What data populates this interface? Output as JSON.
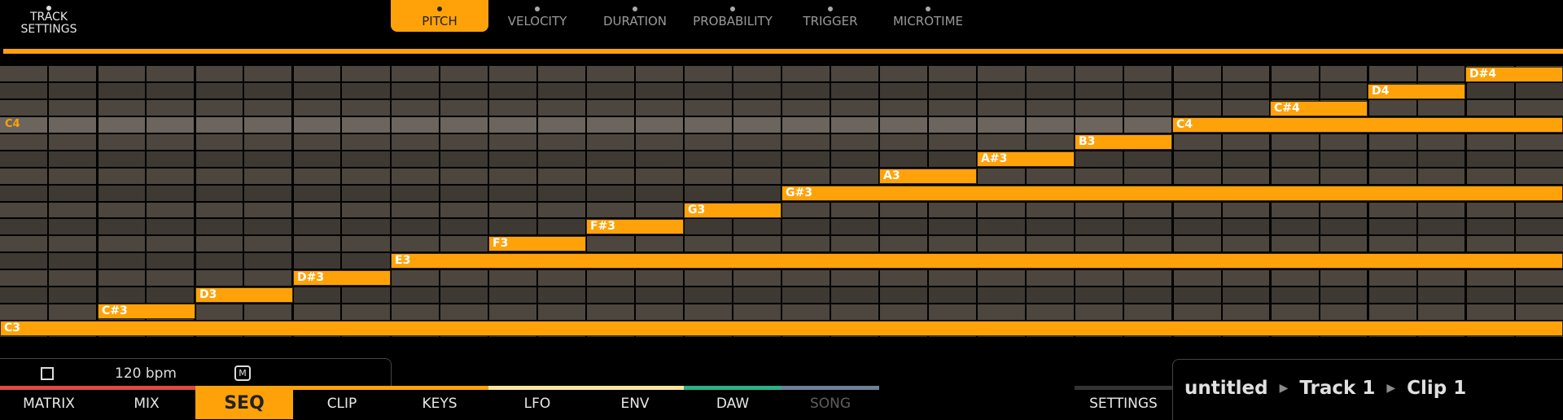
{
  "header": {
    "track_settings": "TRACK\nSETTINGS",
    "tabs": [
      {
        "label": "PITCH"
      },
      {
        "label": "VELOCITY"
      },
      {
        "label": "DURATION"
      },
      {
        "label": "PROBABILITY"
      },
      {
        "label": "TRIGGER"
      },
      {
        "label": "MICROTIME"
      }
    ],
    "active_tab": "PITCH"
  },
  "piano_roll": {
    "row_label": "C4",
    "notes": [
      {
        "label": "D#4",
        "step": 30,
        "length": 2,
        "row": 0
      },
      {
        "label": "D4",
        "step": 28,
        "length": 2,
        "row": 1
      },
      {
        "label": "C#4",
        "step": 26,
        "length": 2,
        "row": 2
      },
      {
        "label": "C4",
        "step": 24,
        "length": 8,
        "row": 3
      },
      {
        "label": "B3",
        "step": 22,
        "length": 2,
        "row": 4
      },
      {
        "label": "A#3",
        "step": 20,
        "length": 2,
        "row": 5
      },
      {
        "label": "A3",
        "step": 18,
        "length": 2,
        "row": 6
      },
      {
        "label": "G#3",
        "step": 16,
        "length": 16,
        "row": 7
      },
      {
        "label": "G3",
        "step": 14,
        "length": 2,
        "row": 8
      },
      {
        "label": "F#3",
        "step": 12,
        "length": 2,
        "row": 9
      },
      {
        "label": "F3",
        "step": 10,
        "length": 2,
        "row": 10
      },
      {
        "label": "E3",
        "step": 8,
        "length": 24,
        "row": 11
      },
      {
        "label": "D#3",
        "step": 6,
        "length": 2,
        "row": 12
      },
      {
        "label": "D3",
        "step": 4,
        "length": 2,
        "row": 13
      },
      {
        "label": "C#3",
        "step": 2,
        "length": 2,
        "row": 14
      },
      {
        "label": "C3",
        "step": 0,
        "length": 32,
        "row": 15
      }
    ]
  },
  "transport": {
    "bpm": "120 bpm",
    "m_label": "M"
  },
  "nav": {
    "items": [
      {
        "label": "MATRIX",
        "color": "#e04848"
      },
      {
        "label": "MIX",
        "color": "#e04848"
      },
      {
        "label": "SEQ",
        "color": "#ffa20a"
      },
      {
        "label": "CLIP",
        "color": "#ffa20a"
      },
      {
        "label": "KEYS",
        "color": "#ffa20a"
      },
      {
        "label": "LFO",
        "color": "#f7e79a"
      },
      {
        "label": "ENV",
        "color": "#f7e79a"
      },
      {
        "label": "DAW",
        "color": "#2bb08a"
      },
      {
        "label": "SONG",
        "color": "#6e7f96"
      }
    ],
    "active": "SEQ",
    "settings": "SETTINGS"
  },
  "breadcrumb": {
    "project": "untitled",
    "track": "Track 1",
    "clip": "Clip 1"
  },
  "colors": {
    "accent": "#ffa20a"
  }
}
